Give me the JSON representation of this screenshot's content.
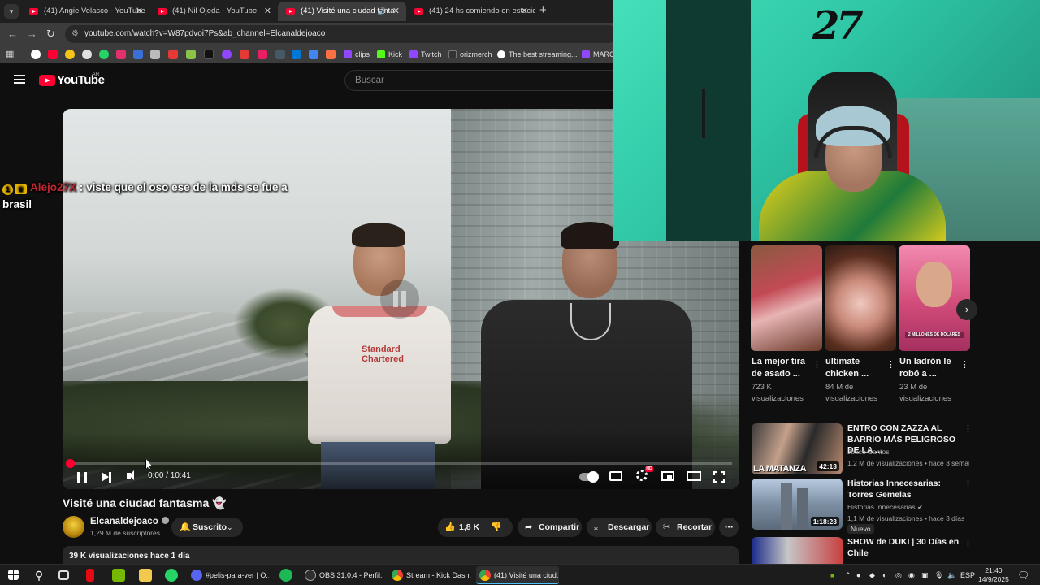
{
  "browser": {
    "tabs": [
      {
        "label": "(41) Angie Velasco - YouTube",
        "active": false
      },
      {
        "label": "(41) Nil Ojeda - YouTube",
        "active": false
      },
      {
        "label": "(41) Visité una ciudad fanta",
        "active": true
      },
      {
        "label": "(41) 24 hs comiendo en estacio",
        "active": false
      }
    ],
    "url": "youtube.com/watch?v=W87pdvoi7Ps&ab_channel=Elcanaldejoaco",
    "bookmarks": [
      "clips",
      "Kick",
      "Twitch",
      "orizmerch",
      "The best streaming...",
      "MARCO"
    ]
  },
  "youtube": {
    "region": "AR",
    "search_placeholder": "Buscar"
  },
  "chat_overlay": {
    "badge": "1",
    "username": "Alejo27X",
    "separator": ":",
    "message": "viste que el oso ese de la mds se fue a brasil"
  },
  "player": {
    "time": "0:00 / 10:41",
    "progress": 0.002,
    "settings_badge": "HD",
    "shirt_text": "Standard Chartered"
  },
  "video": {
    "title": "Visité una ciudad fantasma",
    "title_emoji": "👻",
    "channel": "Elcanaldejoaco",
    "subscribers": "1,29 M de suscriptores",
    "subscribe_label": "Suscrito",
    "likes": "1,8 K",
    "share_label": "Compartir",
    "download_label": "Descargar",
    "clip_label": "Recortar",
    "description_meta": "39 K visualizaciones  hace 1 día"
  },
  "webcam": {
    "wall_logo": "27"
  },
  "shorts": [
    {
      "title": "La mejor tira de asado ...",
      "views": "723 K visualizaciones"
    },
    {
      "title": "ultimate chicken ...",
      "views": "84 M de visualizaciones"
    },
    {
      "title": "Un ladrón le robó a ...",
      "views": "23 M de visualizaciones",
      "thumb_text": "2 MILLONES DE DOLARES"
    }
  ],
  "related": [
    {
      "title": "ENTRO CON ZAZZA AL BARRIO MÁS PELIGROSO DE LA ...",
      "channel": "Joaco Santos",
      "meta": "1,2 M de visualizaciones • hace 3 seman...",
      "duration": "42:13",
      "thumb_text": "LA MATANZA",
      "badge": ""
    },
    {
      "title": "Historias Innecesarias: Torres Gemelas",
      "channel": "Historias Innecesarias",
      "meta": "1,1 M de visualizaciones • hace 3 días",
      "duration": "1:18:23",
      "thumb_text": "",
      "badge": "Nuevo"
    },
    {
      "title": "SHOW de DUKI | 30 Días en Chile",
      "channel": "",
      "meta": "",
      "duration": "",
      "thumb_text": "",
      "badge": ""
    }
  ],
  "taskbar": {
    "apps": [
      {
        "label": "#pelis-para-ver | O..."
      },
      {
        "label": "OBS 31.0.4 - Perfil: ..."
      },
      {
        "label": "Stream - Kick Dash..."
      },
      {
        "label": "(41) Visité una ciud..."
      }
    ],
    "language": "ESP",
    "time": "21:40",
    "date": "14/9/2025"
  },
  "colors": {
    "youtube_red": "#ff0033",
    "background": "#0f0f0f",
    "chip": "#272727",
    "chat_username": "#c0262f"
  }
}
